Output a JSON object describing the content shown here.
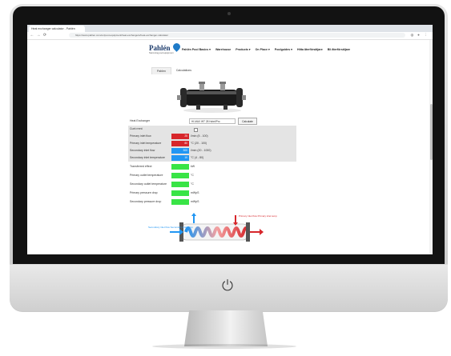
{
  "browser": {
    "tab_title": "Heat exchanger calculator - Pahlén",
    "url": "https://www.pahlen.com/en/pool-equipment/heat-exchangers/heat-exchanger-calculator",
    "nav": {
      "back": "←",
      "forward": "→",
      "reload": "⟳"
    }
  },
  "site": {
    "logo": "Pahlén",
    "tagline": "Swimming pool equipment",
    "menu": [
      "Pahlén Pool Basics ▾",
      "Warehouse",
      "Products ▾",
      "On Place ▾",
      "Poolguides ▾",
      "Hitta återförsäljare",
      "Bli återförsäljare"
    ]
  },
  "tabs": [
    "Pahlen",
    "Calculations"
  ],
  "form": {
    "heat_exchanger_label": "Heat Exchanger",
    "heat_exchanger_value": "HI-MAX WT 28 Hotel/Pro",
    "calculate_label": "Calculate",
    "counter_current_label": "Cunt rrent",
    "inputs": [
      {
        "label": "Primary inlet flow",
        "value": "25",
        "unit": "l/min (5 - 100)",
        "color": "#d7262b"
      },
      {
        "label": "Primary inlet temperature",
        "value": "80",
        "unit": "°C (20 - 100)",
        "color": "#d7262b"
      },
      {
        "label": "Secondary inlet flow",
        "value": "300",
        "unit": "l/min (20 - 1000)",
        "color": "#2196f3"
      },
      {
        "label": "Secondary inlet temperature",
        "value": "10",
        "unit": "°C (4 - 80)",
        "color": "#2196f3"
      }
    ],
    "outputs": [
      {
        "label": "Transferred effect",
        "unit": "kW"
      },
      {
        "label": "Primary outlet temperature",
        "unit": "°C"
      },
      {
        "label": "Secondary outlet temperature",
        "unit": "°C"
      },
      {
        "label": "Primary pressure drop",
        "unit": "mWpS"
      },
      {
        "label": "Secondary pressure drop",
        "unit": "mWpS"
      }
    ]
  },
  "diagram": {
    "left_label": "Secondary inlet flow Secondary inlet temp",
    "right_label": "Primary inlet flow Primary inlet temp"
  },
  "colors": {
    "primary": "#d7262b",
    "secondary": "#2196f3",
    "result": "#39e446",
    "brand": "#1b3a6b"
  }
}
